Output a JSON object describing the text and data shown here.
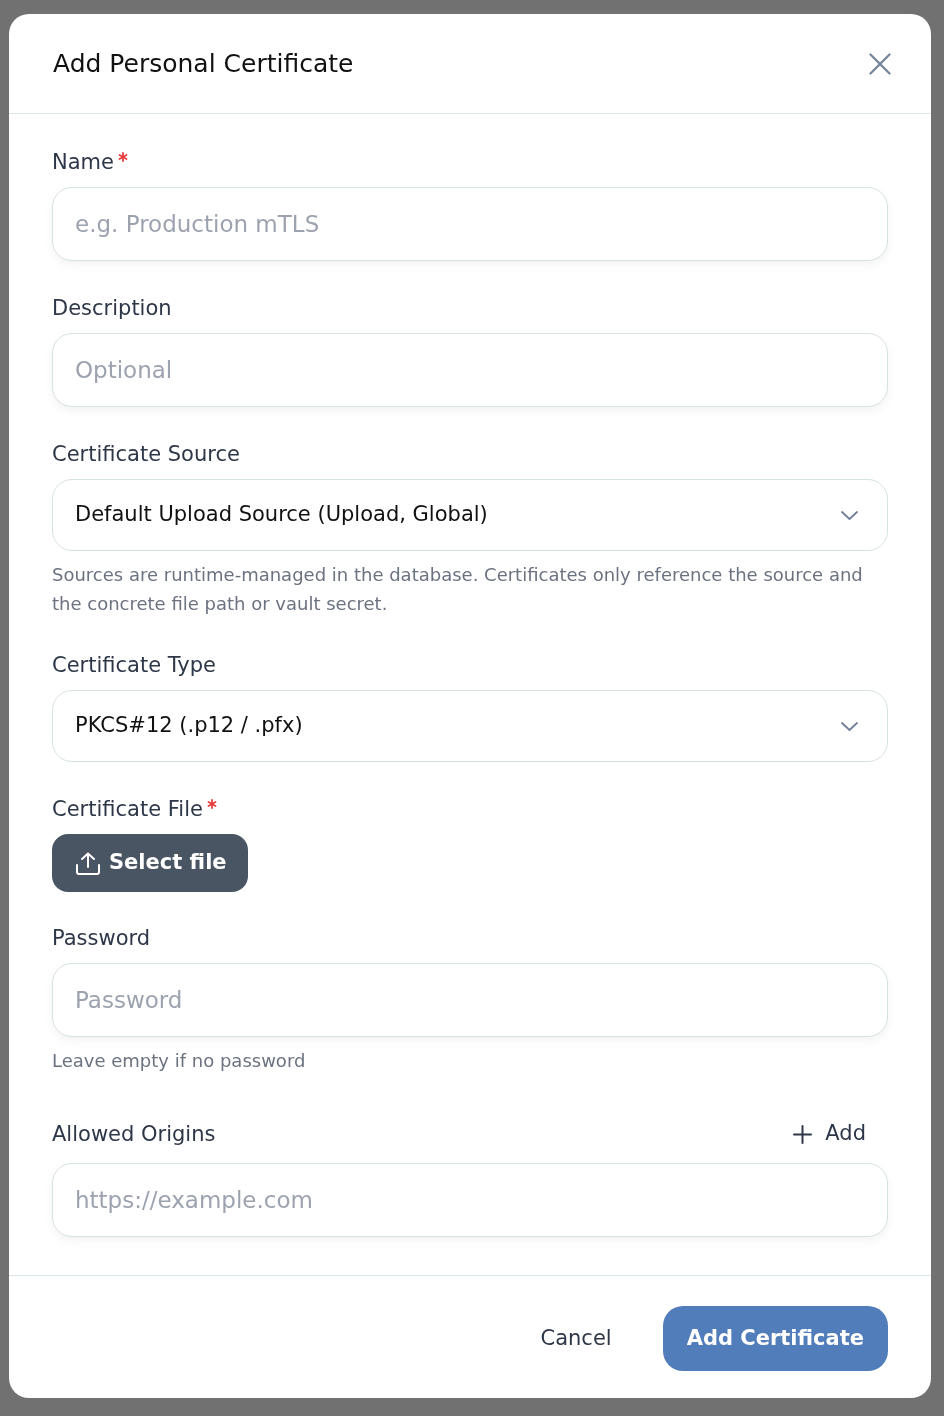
{
  "dialog": {
    "title": "Add Personal Certificate"
  },
  "fields": [
    {
      "kind": "text",
      "label": "Name",
      "required": true,
      "placeholder": "e.g. Production mTLS"
    },
    {
      "kind": "text",
      "label": "Description",
      "required": false,
      "placeholder": "Optional"
    },
    {
      "kind": "select",
      "label": "Certificate Source",
      "required": false,
      "value": "Default Upload Source (Upload, Global)",
      "help": "Sources are runtime-managed in the database. Certificates only reference the source and the concrete file path or vault secret."
    },
    {
      "kind": "select",
      "label": "Certificate Type",
      "required": false,
      "value": "PKCS#12 (.p12 / .pfx)"
    },
    {
      "kind": "file",
      "label": "Certificate File",
      "required": true,
      "button": "Select file"
    },
    {
      "kind": "password",
      "label": "Password",
      "required": false,
      "placeholder": "Password",
      "help": "Leave empty if no password"
    },
    {
      "kind": "list",
      "label": "Allowed Origins",
      "required": false,
      "add_button": "Add",
      "placeholder": "https://example.com"
    }
  ],
  "footer": {
    "buttons": [
      {
        "kind": "secondary",
        "label": "Cancel"
      },
      {
        "kind": "primary",
        "label": "Add Certificate"
      }
    ]
  }
}
